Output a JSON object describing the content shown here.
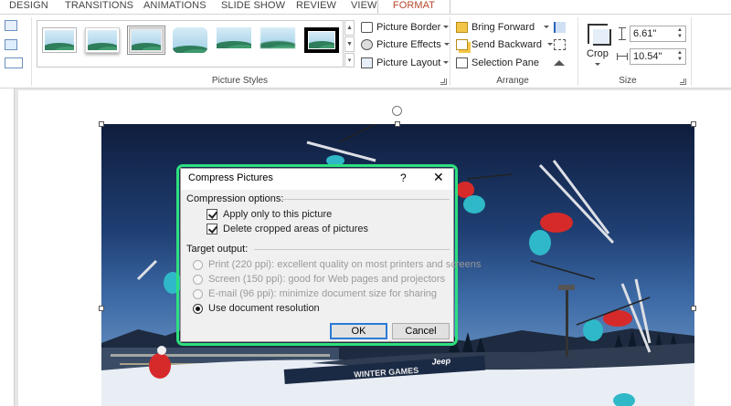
{
  "tabs": [
    "DESIGN",
    "TRANSITIONS",
    "ANIMATIONS",
    "SLIDE SHOW",
    "REVIEW",
    "VIEW",
    "FORMAT"
  ],
  "active_tab_index": 6,
  "picture_styles": {
    "group_label": "Picture Styles",
    "buttons": [
      {
        "label": "Picture Border",
        "icon": "picture-border-icon"
      },
      {
        "label": "Picture Effects",
        "icon": "picture-effects-icon"
      },
      {
        "label": "Picture Layout",
        "icon": "picture-layout-icon"
      }
    ]
  },
  "arrange": {
    "group_label": "Arrange",
    "buttons": [
      {
        "label": "Bring Forward",
        "icon": "bring-forward-icon"
      },
      {
        "label": "Send Backward",
        "icon": "send-backward-icon"
      },
      {
        "label": "Selection Pane",
        "icon": "selection-pane-icon"
      }
    ]
  },
  "size": {
    "group_label": "Size",
    "crop_label": "Crop",
    "height": "6.61\"",
    "width": "10.54\""
  },
  "dialog": {
    "title": "Compress Pictures",
    "help": "?",
    "close": "✕",
    "compression_heading": "Compression options:",
    "apply_only": "Apply only to this picture",
    "delete_cropped": "Delete cropped areas of pictures",
    "target_heading": "Target output:",
    "options": [
      {
        "label": "Print (220 ppi): excellent quality on most printers and screens",
        "enabled": false,
        "selected": false
      },
      {
        "label": "Screen (150 ppi): good for Web pages and projectors",
        "enabled": false,
        "selected": false
      },
      {
        "label": "E-mail (96 ppi): minimize document size for sharing",
        "enabled": false,
        "selected": false
      },
      {
        "label": "Use document resolution",
        "enabled": true,
        "selected": true
      }
    ],
    "ok": "OK",
    "cancel": "Cancel"
  },
  "photo_banner": {
    "winter_games": "WINTER GAMES",
    "jeep": "Jeep"
  }
}
